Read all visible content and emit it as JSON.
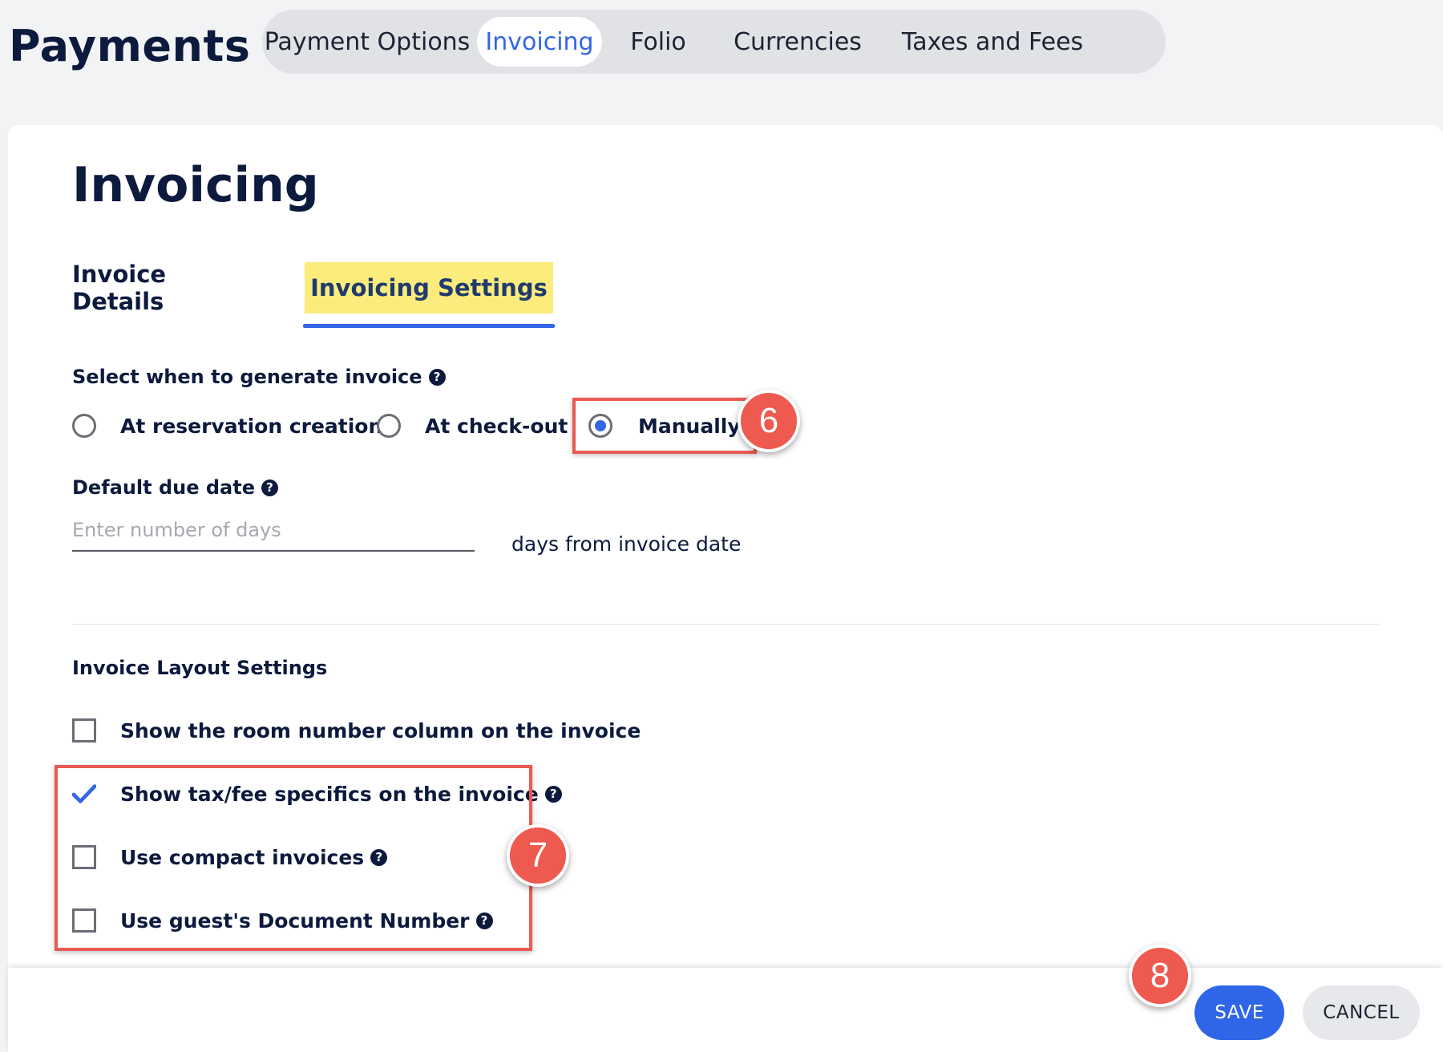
{
  "header": {
    "title": "Payments",
    "tabs": [
      {
        "label": "Payment Options",
        "active": false
      },
      {
        "label": "Invoicing",
        "active": true
      },
      {
        "label": "Folio",
        "active": false
      },
      {
        "label": "Currencies",
        "active": false
      },
      {
        "label": "Taxes and Fees",
        "active": false
      }
    ]
  },
  "section": {
    "title": "Invoicing",
    "sub_tabs": [
      {
        "label": "Invoice Details",
        "active": false
      },
      {
        "label": "Invoicing Settings",
        "active": true
      }
    ]
  },
  "generate": {
    "label": "Select when to generate invoice",
    "options": [
      {
        "label": "At reservation creation",
        "selected": false
      },
      {
        "label": "At check-out",
        "selected": false
      },
      {
        "label": "Manually",
        "selected": true
      }
    ]
  },
  "due_date": {
    "label": "Default due date",
    "placeholder": "Enter number of days",
    "value": "",
    "suffix": "days from invoice date"
  },
  "layout": {
    "title": "Invoice Layout Settings",
    "options": [
      {
        "label": "Show the room number column on the invoice",
        "checked": false,
        "help": false
      },
      {
        "label": "Show tax/fee specifics on the invoice",
        "checked": true,
        "help": true
      },
      {
        "label": "Use compact invoices",
        "checked": false,
        "help": true
      },
      {
        "label": "Use guest's Document Number",
        "checked": false,
        "help": true
      }
    ]
  },
  "callouts": {
    "six": "6",
    "seven": "7",
    "eight": "8"
  },
  "footer": {
    "save_label": "SAVE",
    "cancel_label": "CANCEL"
  },
  "colors": {
    "accent": "#3366e6",
    "highlight": "#fbec7c",
    "callout": "#ee5a4f",
    "text": "#0c1a3d"
  }
}
